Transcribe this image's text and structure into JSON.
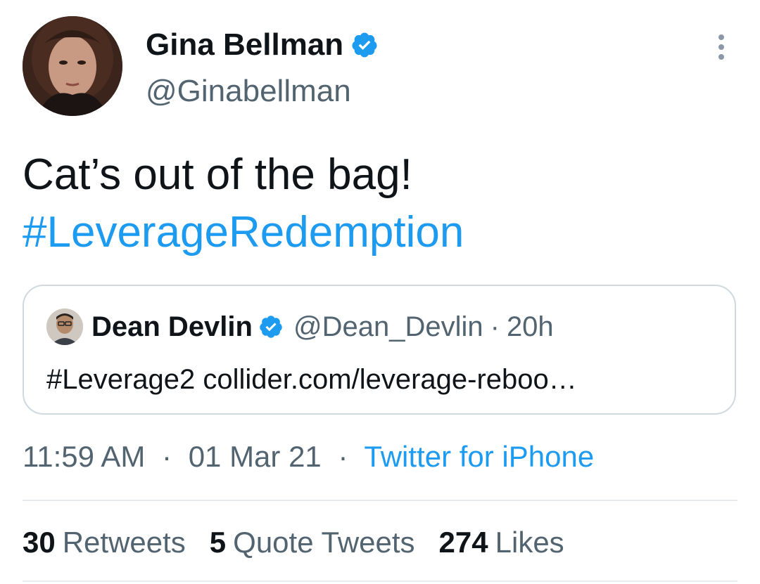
{
  "author": {
    "name": "Gina Bellman",
    "handle": "@Ginabellman",
    "verified": true,
    "avatar_icon": "profile-photo"
  },
  "menu_icon": "more-vertical-icon",
  "tweet": {
    "text_line1": "Cat’s out of the bag!",
    "hashtag": "#LeverageRedemption"
  },
  "quoted_tweet": {
    "name": "Dean Devlin",
    "handle": "@Dean_Devlin",
    "separator": "·",
    "time": "20h",
    "text": "#Leverage2 collider.com/leverage-reboo…",
    "verified": true
  },
  "meta": {
    "time": "11:59 AM",
    "separator": "·",
    "date": "01 Mar 21",
    "source": "Twitter for iPhone"
  },
  "stats": {
    "retweets_count": "30",
    "retweets_label": "Retweets",
    "quotes_count": "5",
    "quotes_label": "Quote Tweets",
    "likes_count": "274",
    "likes_label": "Likes"
  },
  "colors": {
    "accent": "#1d9bf0",
    "text": "#0f1419",
    "secondary": "#536471",
    "border": "#cfd9de"
  }
}
